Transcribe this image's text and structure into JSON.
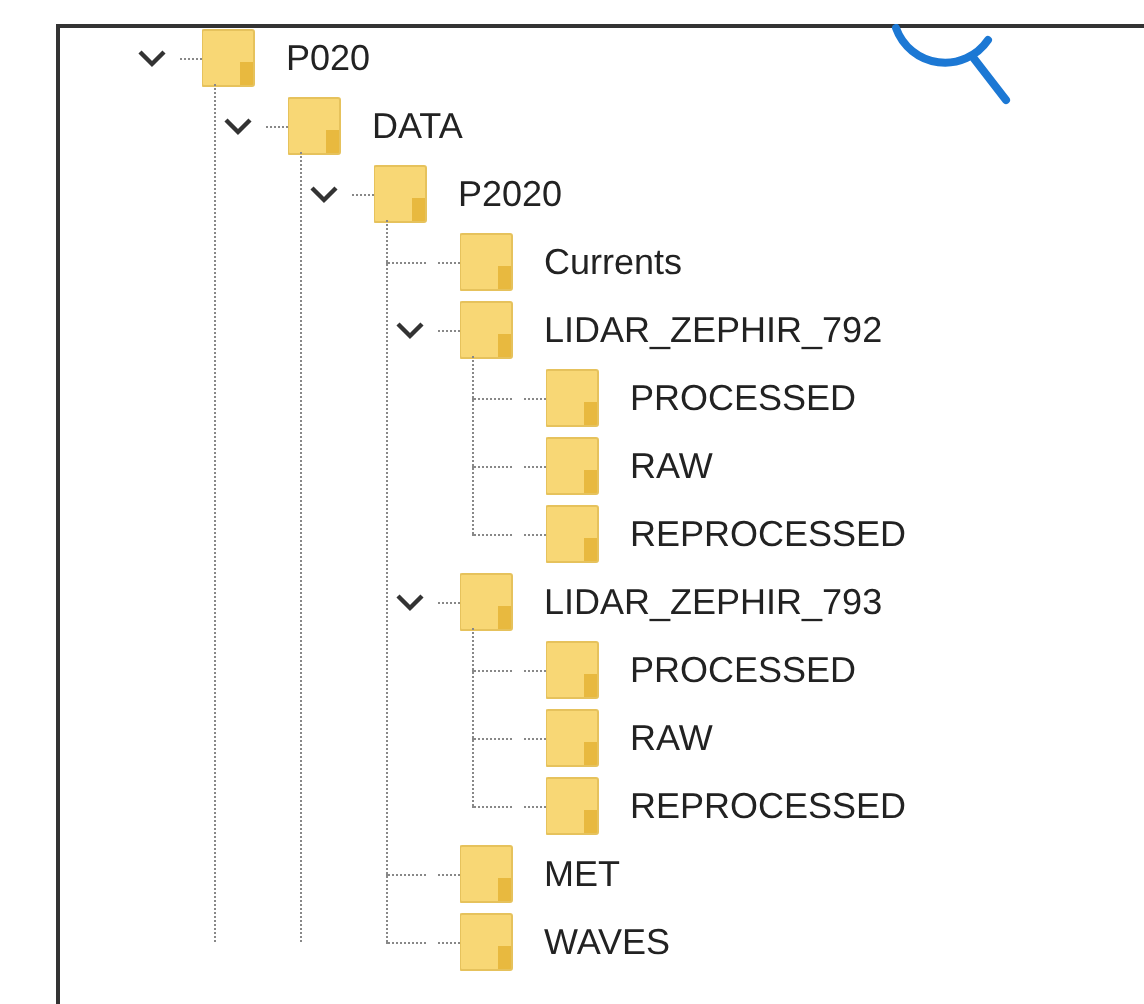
{
  "tree": [
    {
      "label": "P020",
      "expanded": true,
      "children": [
        {
          "label": "DATA",
          "expanded": true,
          "children": [
            {
              "label": "P2020",
              "expanded": true,
              "children": [
                {
                  "label": "Currents"
                },
                {
                  "label": "LIDAR_ZEPHIR_792",
                  "expanded": true,
                  "children": [
                    {
                      "label": "PROCESSED"
                    },
                    {
                      "label": "RAW"
                    },
                    {
                      "label": "REPROCESSED"
                    }
                  ]
                },
                {
                  "label": "LIDAR_ZEPHIR_793",
                  "expanded": true,
                  "children": [
                    {
                      "label": "PROCESSED"
                    },
                    {
                      "label": "RAW"
                    },
                    {
                      "label": "REPROCESSED"
                    }
                  ]
                },
                {
                  "label": "MET"
                },
                {
                  "label": "WAVES"
                }
              ]
            }
          ]
        }
      ]
    }
  ]
}
